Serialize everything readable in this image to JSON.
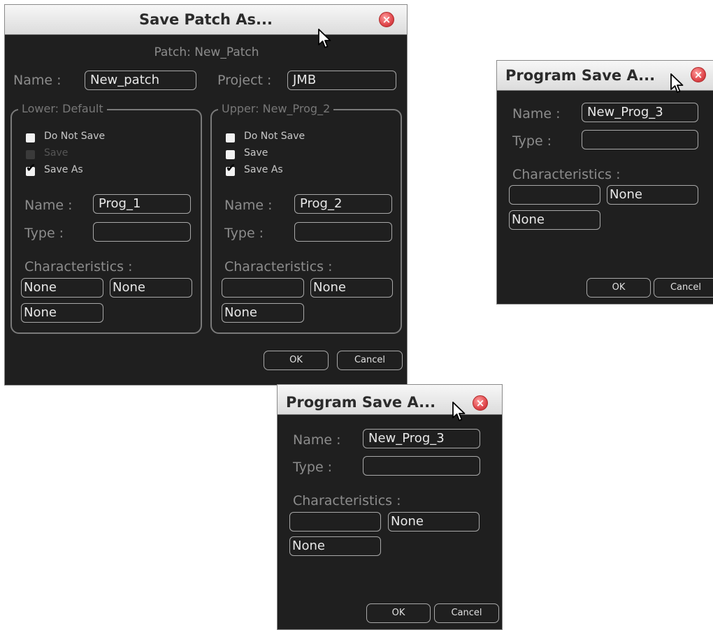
{
  "patch_dialog": {
    "title": "Save Patch As...",
    "subtitle": "Patch: New_Patch",
    "name_label": "Name :",
    "name_value": "New_patch",
    "project_label": "Project :",
    "project_value": "JMB",
    "lower": {
      "legend": "Lower: Default",
      "options": [
        "Do Not Save",
        "Save",
        "Save As"
      ],
      "name_label": "Name :",
      "name_value": "Prog_1",
      "type_label": "Type :",
      "type_value": "",
      "char_label": "Characteristics :",
      "char1": "None",
      "char2": "None",
      "char3": "None"
    },
    "upper": {
      "legend": "Upper: New_Prog_2",
      "options": [
        "Do Not Save",
        "Save",
        "Save As"
      ],
      "name_label": "Name :",
      "name_value": "Prog_2",
      "type_label": "Type :",
      "type_value": "",
      "char_label": "Characteristics :",
      "char1": "",
      "char2": "None",
      "char3": "None"
    },
    "ok": "OK",
    "cancel": "Cancel"
  },
  "prog_dialog_right": {
    "title": "Program Save A...",
    "name_label": "Name :",
    "name_value": "New_Prog_3",
    "type_label": "Type :",
    "type_value": "",
    "char_label": "Characteristics :",
    "char1": "",
    "char2": "None",
    "char3": "None",
    "ok": "OK",
    "cancel": "Cancel"
  },
  "prog_dialog_bottom": {
    "title": "Program Save A...",
    "name_label": "Name :",
    "name_value": "New_Prog_3",
    "type_label": "Type :",
    "type_value": "",
    "char_label": "Characteristics :",
    "char1": "",
    "char2": "None",
    "char3": "None",
    "ok": "OK",
    "cancel": "Cancel"
  },
  "colors": {
    "dialog_bg": "#1f1f1f",
    "titlebar": "#e6e6e6",
    "label": "#8c8c8c",
    "close": "#e0474c"
  },
  "icons": [
    "close-icon",
    "mouse-cursor-icon",
    "checkbox-icon",
    "checkmark-icon"
  ]
}
